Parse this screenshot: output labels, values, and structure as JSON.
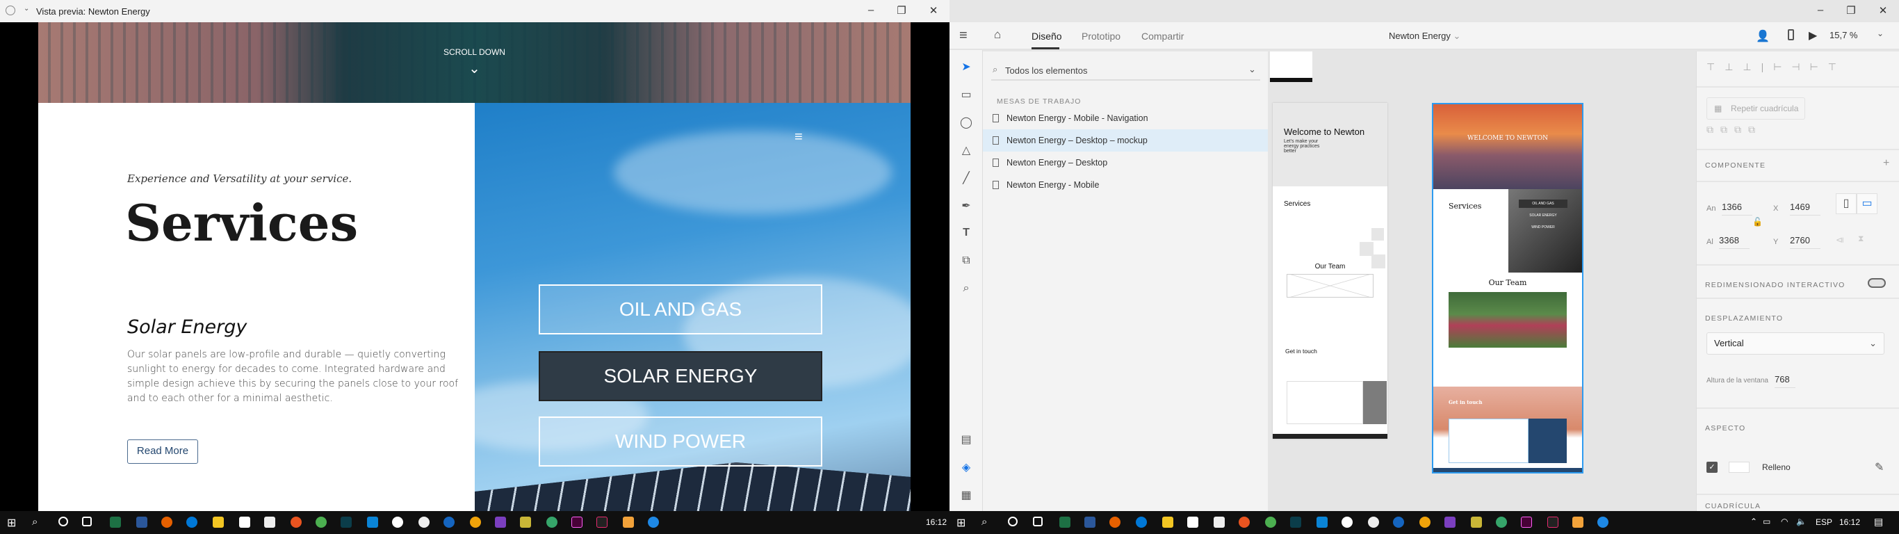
{
  "preview": {
    "title": "Vista previa: Newton Energy",
    "scroll_down": "SCROLL DOWN",
    "tagline": "Experience and Versatility at your service.",
    "heading": "Services",
    "service_title": "Solar Energy",
    "service_body": "Our solar panels are low-profile and durable — quietly converting sunlight to energy for decades to come. Integrated hardware and simple design achieve this by securing the panels close to your roof and to each other for a minimal aesthetic.",
    "read_more": "Read More",
    "services": [
      "OIL AND GAS",
      "SOLAR ENERGY",
      "WIND POWER"
    ]
  },
  "xd": {
    "tabs": [
      "Diseño",
      "Prototipo",
      "Compartir"
    ],
    "doc_title": "Newton Energy",
    "zoom": "15,7 %",
    "search_placeholder": "Todos los elementos",
    "layers_header": "MESAS DE TRABAJO",
    "artboards": [
      "Newton Energy - Mobile - Navigation",
      "Newton Energy – Desktop – mockup",
      "Newton Energy – Desktop",
      "Newton Energy - Mobile"
    ],
    "canvas": {
      "wire": {
        "welcome": "Welcome to Newton",
        "sub": "Let's make your energy practices better",
        "services": "Services",
        "team": "Our Team",
        "touch": "Get in touch"
      },
      "mock": {
        "welcome": "WELCOME TO NEWTON",
        "services": "Services",
        "team": "Our Team",
        "touch": "Get in touch",
        "btns": [
          "OIL AND GAS",
          "SOLAR ENERGY",
          "WIND POWER"
        ]
      }
    },
    "props": {
      "repeat_grid": "Repetir cuadrícula",
      "component": "COMPONENTE",
      "w_label": "An",
      "w": "1366",
      "x_label": "X",
      "x": "1469",
      "h_label": "Al",
      "h": "3368",
      "y_label": "Y",
      "y": "2760",
      "responsive": "REDIMENSIONADO INTERACTIVO",
      "scrolling": "DESPLAZAMIENTO",
      "scroll_value": "Vertical",
      "viewport_label": "Altura de la ventana",
      "viewport": "768",
      "appearance": "ASPECTO",
      "fill": "Relleno",
      "grid": "CUADRÍCULA"
    }
  },
  "taskbar": {
    "time_left": "16:12",
    "lang": "ESP",
    "time_right": "16:12"
  },
  "colors": {
    "accent": "#1473e6",
    "selection": "#dfedf8",
    "navy": "#24476f"
  }
}
